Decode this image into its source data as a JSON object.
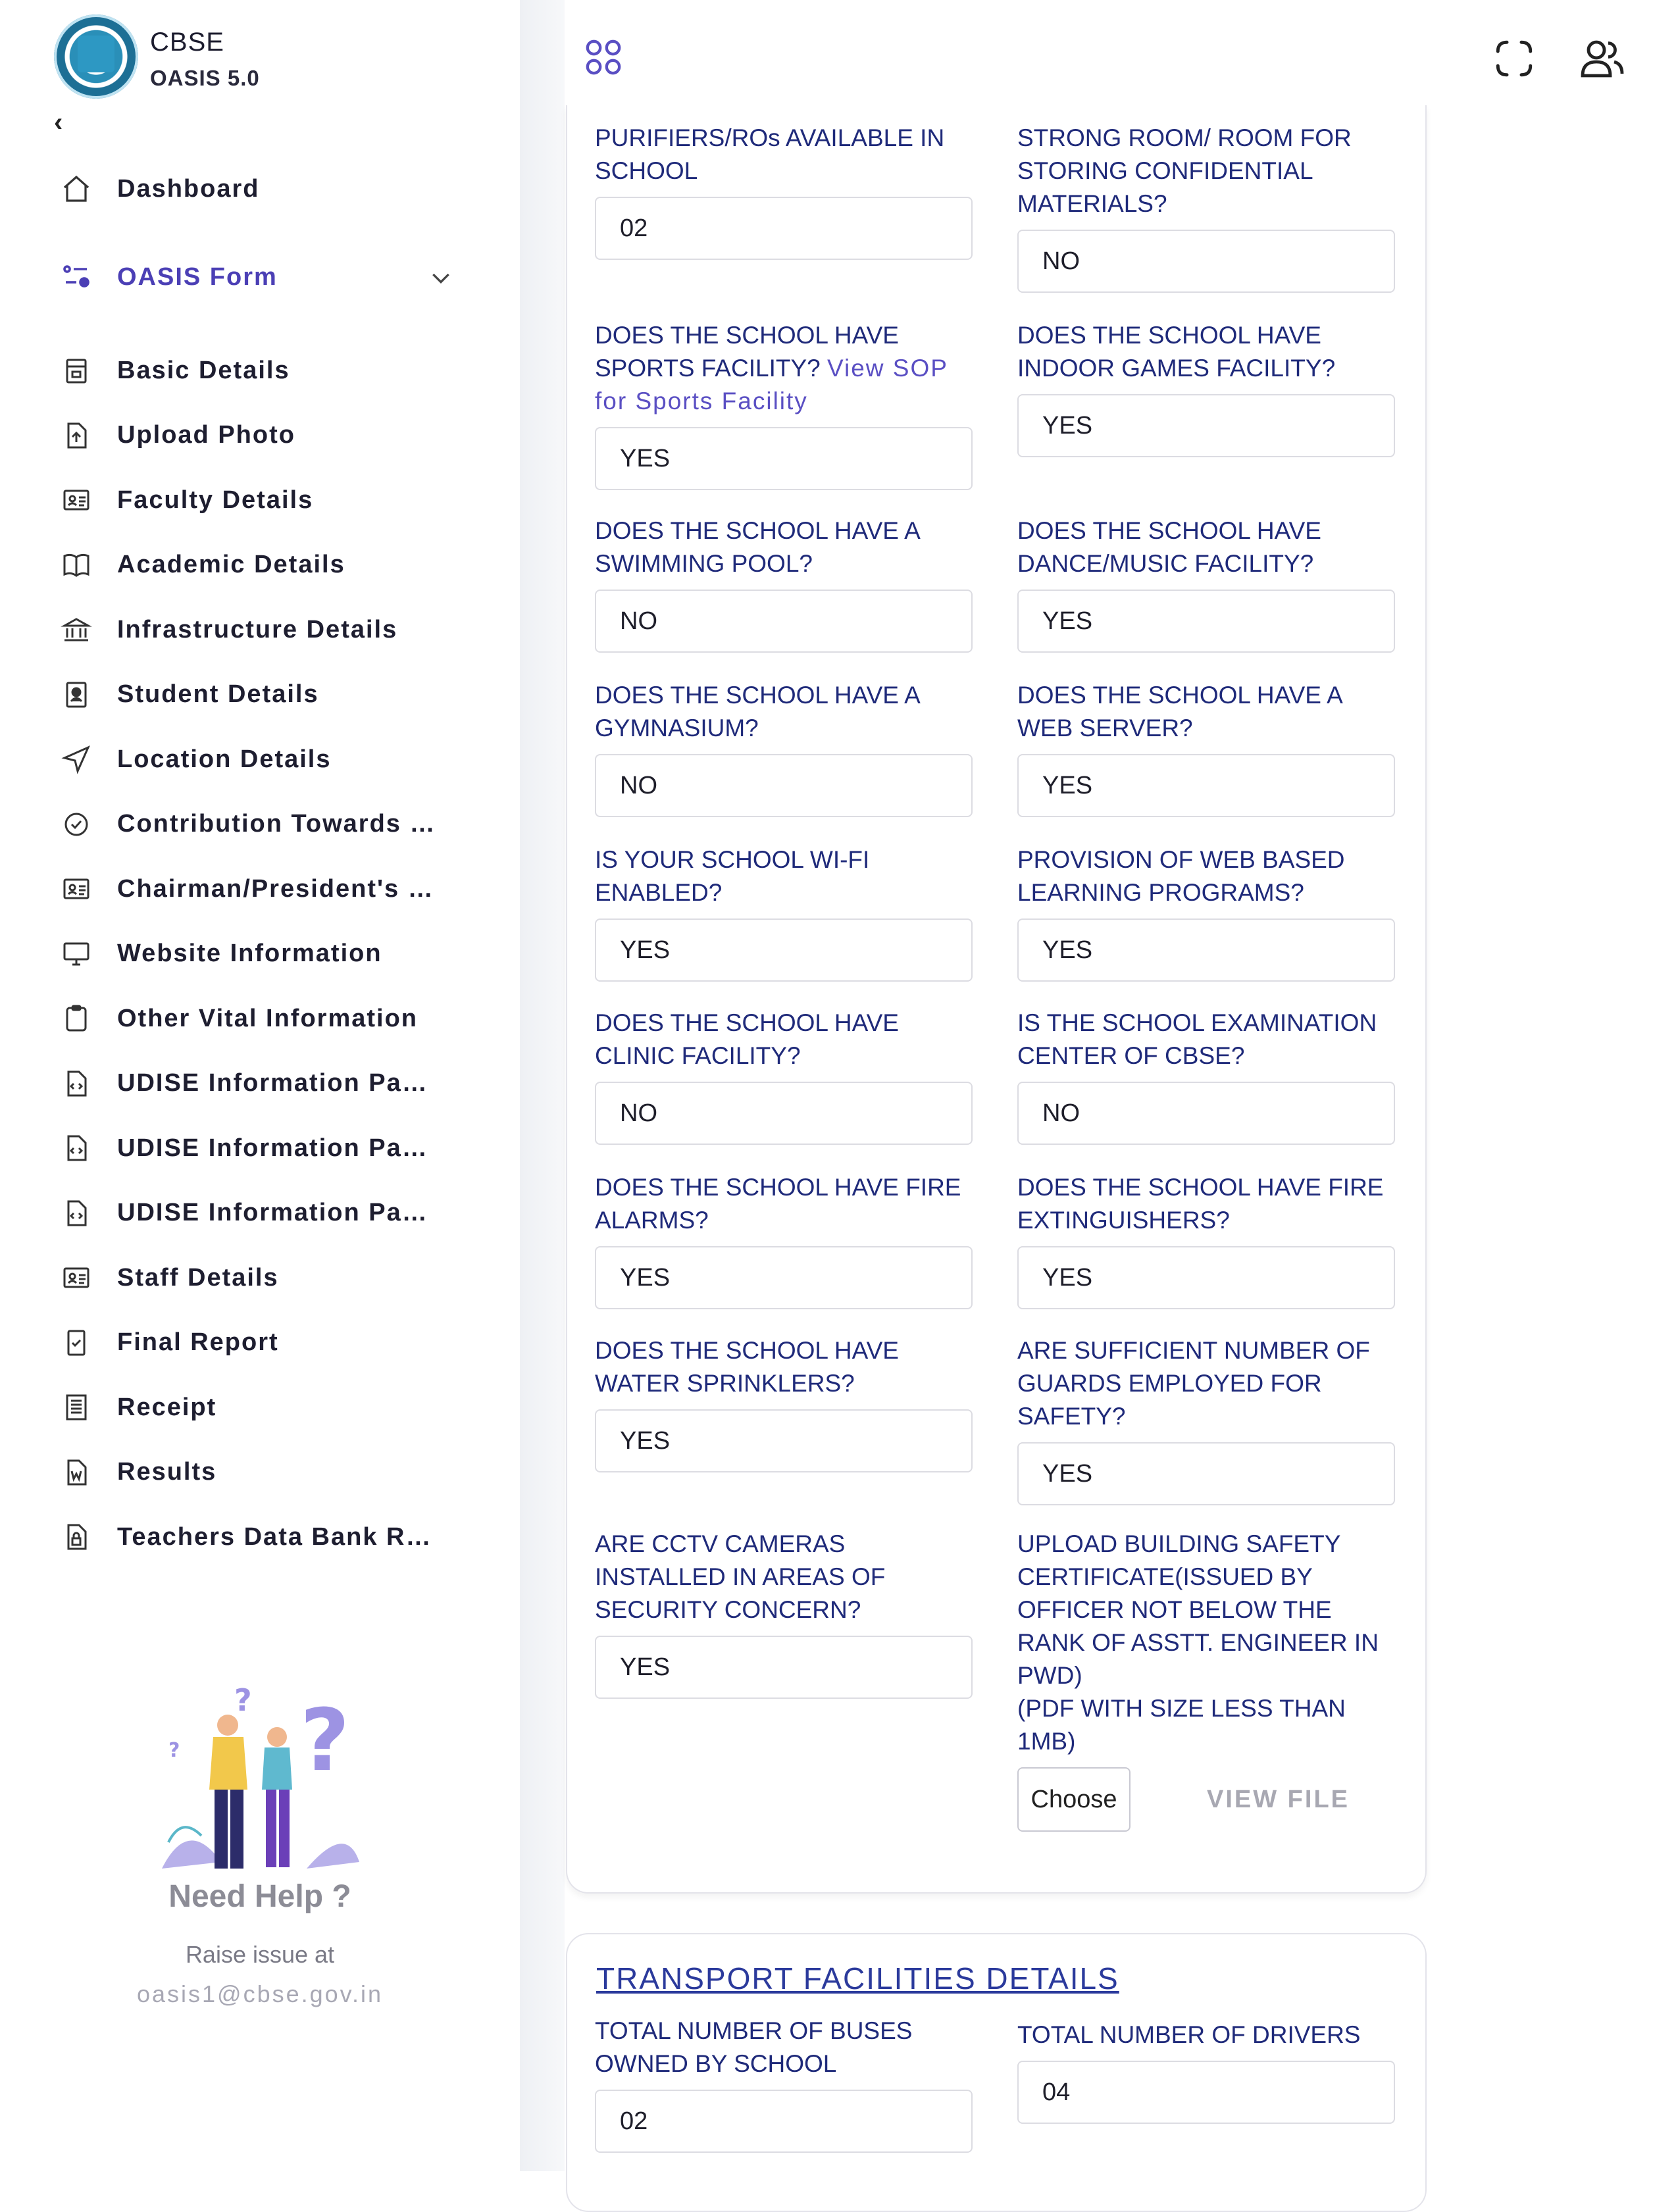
{
  "brand": {
    "title": "CBSE",
    "subtitle": "OASIS 5.0"
  },
  "sidebar": {
    "collapse_glyph": "‹",
    "dashboard": "Dashboard",
    "oasis_form": "OASIS Form",
    "items": [
      {
        "label": "Basic Details",
        "icon": "building-icon"
      },
      {
        "label": "Upload Photo",
        "icon": "upload-file-icon"
      },
      {
        "label": "Faculty Details",
        "icon": "id-card-icon"
      },
      {
        "label": "Academic Details",
        "icon": "book-icon"
      },
      {
        "label": "Infrastructure Details",
        "icon": "bank-icon"
      },
      {
        "label": "Student Details",
        "icon": "student-icon"
      },
      {
        "label": "Location Details",
        "icon": "send-icon"
      },
      {
        "label": "Contribution Towards …",
        "icon": "badge-check-icon"
      },
      {
        "label": "Chairman/President's …",
        "icon": "id-card-icon"
      },
      {
        "label": "Website Information",
        "icon": "monitor-icon"
      },
      {
        "label": "Other Vital Information",
        "icon": "clipboard-icon"
      },
      {
        "label": "UDISE Information Pa…",
        "icon": "code-file-icon"
      },
      {
        "label": "UDISE Information Pa…",
        "icon": "code-file-icon"
      },
      {
        "label": "UDISE Information Pa…",
        "icon": "code-file-icon"
      },
      {
        "label": "Staff Details",
        "icon": "id-card-icon"
      },
      {
        "label": "Final Report",
        "icon": "check-file-icon"
      },
      {
        "label": "Receipt",
        "icon": "receipt-icon"
      },
      {
        "label": "Results",
        "icon": "word-file-icon"
      },
      {
        "label": "Teachers Data Bank R…",
        "icon": "lock-file-icon"
      }
    ],
    "help": {
      "title": "Need Help ?",
      "raise": "Raise issue at",
      "email": "oasis1@cbse.gov.in"
    }
  },
  "form": {
    "left": [
      {
        "label": "PURIFIERS/ROs AVAILABLE IN SCHOOL",
        "value": "02"
      },
      {
        "label": "DOES THE SCHOOL HAVE SPORTS FACILITY?",
        "link": "View SOP for Sports Facility",
        "value": "YES"
      },
      {
        "label": "DOES THE SCHOOL HAVE A SWIMMING POOL?",
        "value": "NO"
      },
      {
        "label": "DOES THE SCHOOL HAVE A GYMNASIUM?",
        "value": "NO"
      },
      {
        "label": "IS YOUR SCHOOL WI-FI ENABLED?",
        "value": "YES"
      },
      {
        "label": "DOES THE SCHOOL HAVE CLINIC FACILITY?",
        "value": "NO"
      },
      {
        "label": "DOES THE SCHOOL HAVE FIRE ALARMS?",
        "value": "YES"
      },
      {
        "label": "DOES THE SCHOOL HAVE WATER SPRINKLERS?",
        "value": "YES"
      },
      {
        "label": "ARE CCTV CAMERAS INSTALLED IN AREAS OF SECURITY CONCERN?",
        "value": "YES"
      }
    ],
    "right": [
      {
        "label": "STRONG ROOM/ ROOM FOR STORING CONFIDENTIAL MATERIALS?",
        "value": "NO"
      },
      {
        "label": "DOES THE SCHOOL HAVE INDOOR GAMES FACILITY?",
        "value": "YES"
      },
      {
        "label": "DOES THE SCHOOL HAVE DANCE/MUSIC FACILITY?",
        "value": "YES"
      },
      {
        "label": "DOES THE SCHOOL HAVE A WEB SERVER?",
        "value": "YES"
      },
      {
        "label": "PROVISION OF WEB BASED LEARNING PROGRAMS?",
        "value": "YES"
      },
      {
        "label": "IS THE SCHOOL EXAMINATION CENTER OF CBSE?",
        "value": "NO"
      },
      {
        "label": "DOES THE SCHOOL HAVE FIRE EXTINGUISHERS?",
        "value": "YES"
      },
      {
        "label": "ARE SUFFICIENT NUMBER OF GUARDS EMPLOYED FOR SAFETY?",
        "value": "YES"
      }
    ],
    "upload": {
      "label": "UPLOAD BUILDING SAFETY CERTIFICATE(ISSUED BY OFFICER NOT BELOW THE RANK OF ASSTT. ENGINEER IN PWD)",
      "note": "(PDF WITH SIZE LESS THAN 1MB)",
      "choose": "Choose",
      "view": "VIEW FILE"
    }
  },
  "transport": {
    "title": "TRANSPORT FACILITIES DETAILS",
    "buses_label": "TOTAL NUMBER OF BUSES OWNED BY SCHOOL",
    "buses_value": "02",
    "drivers_label": "TOTAL NUMBER OF DRIVERS",
    "drivers_value": "04"
  },
  "colors": {
    "label": "#1f2a7a",
    "accent": "#5a4fc3",
    "active_nav": "#4b3fb5"
  }
}
